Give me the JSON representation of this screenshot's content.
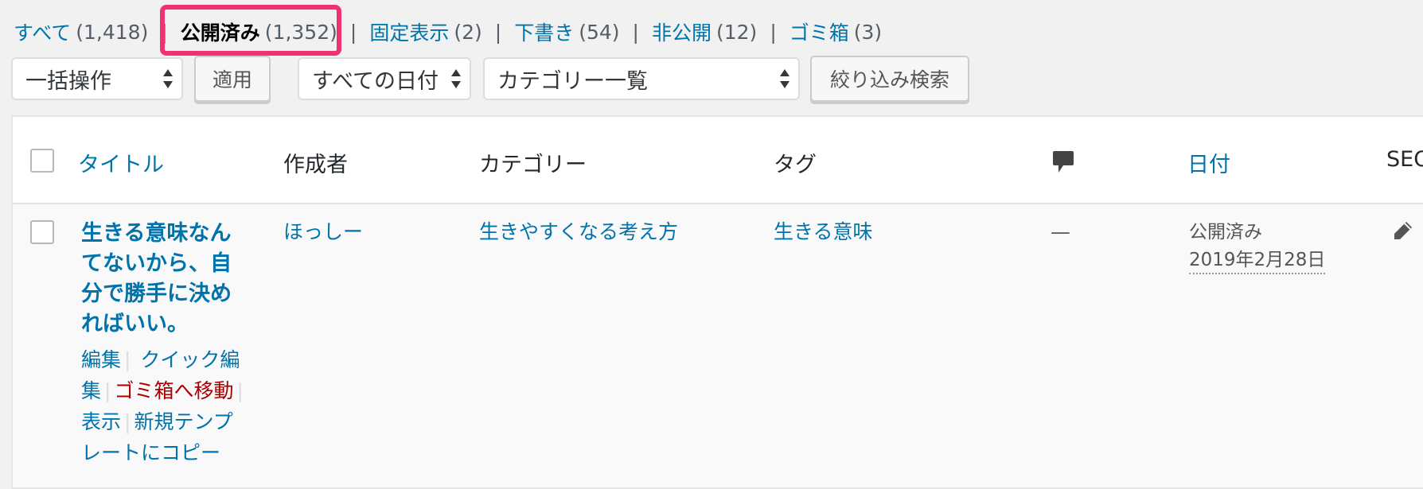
{
  "status_filters": [
    {
      "label": "すべて",
      "count": "(1,418)"
    },
    {
      "label": "公開済み",
      "count": "(1,352)",
      "current": true
    },
    {
      "label": "固定表示",
      "count": "(2)"
    },
    {
      "label": "下書き",
      "count": "(54)"
    },
    {
      "label": "非公開",
      "count": "(12)"
    },
    {
      "label": "ゴミ箱",
      "count": "(3)"
    }
  ],
  "separator": "|",
  "tablenav": {
    "bulk_action_selected": "一括操作",
    "apply_label": "適用",
    "date_filter_selected": "すべての日付",
    "category_filter_selected": "カテゴリー一覧",
    "filter_label": "絞り込み検索"
  },
  "columns": {
    "title": "タイトル",
    "author": "作成者",
    "categories": "カテゴリー",
    "tags": "タグ",
    "comments_icon": "comment-bubble-icon",
    "date": "日付",
    "seo": "SEO"
  },
  "rows": [
    {
      "title": "生きる意味なんてないから、自分で勝手に決めればいい。",
      "author": "ほっしー",
      "category": "生きやすくなる考え方",
      "tag": "生きる意味",
      "comments": "—",
      "date_status": "公開済み",
      "date": "2019年2月28日",
      "seo_icon": "pencil-icon",
      "actions": {
        "edit": "編集",
        "quick_edit": "クイック編集",
        "trash": "ゴミ箱へ移動",
        "view": "表示",
        "copy_template": "新規テンプレートにコピー"
      }
    }
  ],
  "colors": {
    "link": "#0073aa",
    "highlight": "#f0336e",
    "trash": "#aa0000",
    "background": "#f1f1f1"
  }
}
